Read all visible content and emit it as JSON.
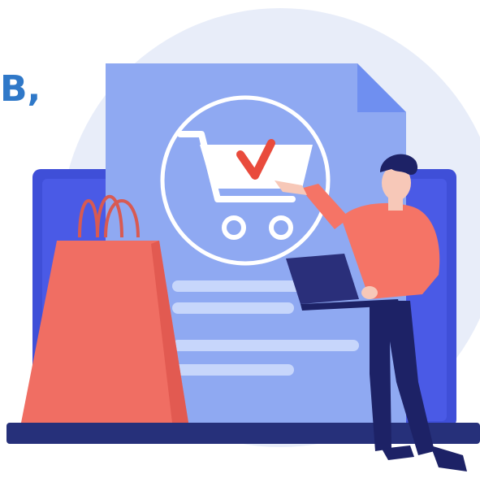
{
  "text_fragment": "В,",
  "colors": {
    "accent_text": "#2f78c8",
    "background_circle": "#e8edf9",
    "document": "#8fa9f2",
    "document_fold": "#6f8ff0",
    "laptop_screen": "#3f4fd8",
    "laptop_base": "#26307a",
    "bag": "#f06e63",
    "bag_handle": "#d85a52",
    "cart_check": "#e94b3c",
    "person_shirt": "#f57466",
    "person_hair": "#1d2266",
    "person_pants": "#1d2266",
    "skin": "#f7c8b8",
    "handheld_laptop": "#2a2f7a",
    "lines": "#c7d6fb",
    "white": "#ffffff"
  },
  "icons": [
    "shopping-cart-icon",
    "checkmark-icon",
    "shopping-bag-icon",
    "laptop-icon",
    "document-icon",
    "person-illustration"
  ]
}
